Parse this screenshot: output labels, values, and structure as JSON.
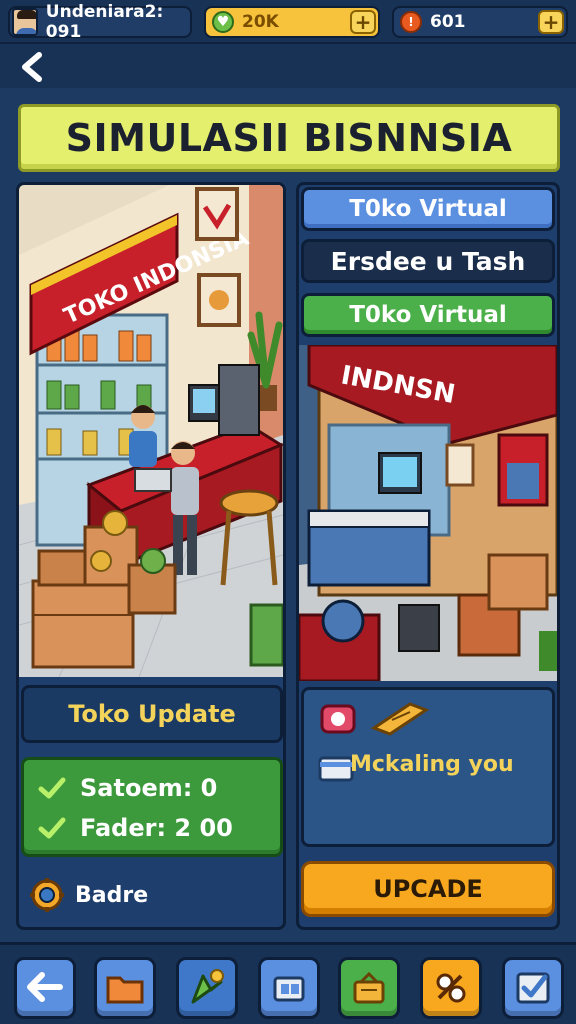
{
  "topbar": {
    "username": "Undeniara2: 091",
    "gold_value": "20K",
    "coin_value": "601"
  },
  "title": "SIMULASII BISNNSIA",
  "left_panel": {
    "store_sign": "TOKO INDONSIA",
    "status_label": "Toko Update",
    "stats": [
      {
        "label": "Satoem: 0"
      },
      {
        "label": "Fader: 2 00"
      }
    ],
    "badge_label": "Badre"
  },
  "right_panel": {
    "tabs": [
      {
        "label": "T0ko Virtual",
        "style": "blue"
      },
      {
        "label": "Ersdee u Tash",
        "style": "dark"
      },
      {
        "label": "T0ko Virtual",
        "style": "green"
      }
    ],
    "store_sign": "INDNSN",
    "info_text": "Mckaling you",
    "upgrade_label": "UPCADE"
  },
  "bottom_nav": [
    {
      "icon": "back-arrow-icon",
      "color": "#5b8fe0"
    },
    {
      "icon": "folder-icon",
      "color": "#5b8fe0"
    },
    {
      "icon": "map-marker-icon",
      "color": "#3f78c8"
    },
    {
      "icon": "inventory-icon",
      "color": "#5b8fe0"
    },
    {
      "icon": "shop-basket-icon",
      "color": "#4bb04a"
    },
    {
      "icon": "handshake-icon",
      "color": "#f7a81f"
    },
    {
      "icon": "checklist-icon",
      "color": "#5b8fe0"
    }
  ],
  "colors": {
    "background": "#1d3a63",
    "title_banner": "#e4ef6e",
    "accent_yellow": "#f3d35a",
    "green": "#4bb04a",
    "orange": "#f7a81f",
    "blue": "#5b8fe0"
  }
}
